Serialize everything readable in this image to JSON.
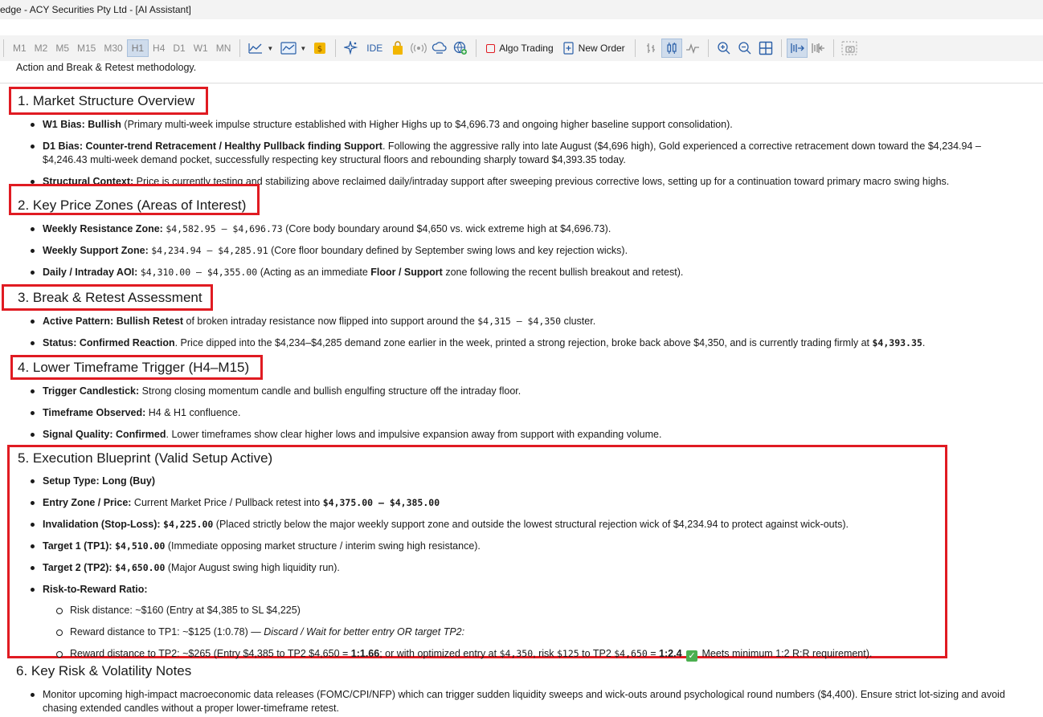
{
  "window": {
    "title": "edge - ACY Securities Pty Ltd - [AI Assistant]"
  },
  "toolbar": {
    "periods": [
      "M1",
      "M5",
      "M15",
      "M30",
      "H1",
      "H4",
      "D1",
      "W1",
      "MN"
    ],
    "periods_visible": [
      "M1",
      "M2",
      "M5",
      "M15",
      "M30",
      "H1",
      "H4",
      "D1",
      "W1",
      "MN"
    ],
    "active_period": "H1",
    "ide_label": "IDE",
    "algo_trading_label": "Algo Trading",
    "new_order_label": "New Order",
    "colors": {
      "algo_stop": "#e01b22",
      "active_bg": "#cfdcec"
    }
  },
  "intro_tail": "Action and Break & Retest methodology.",
  "sections": {
    "s1": {
      "title": "1. Market Structure Overview",
      "b1_label": "W1 Bias: Bullish",
      "b1_text": " (Primary multi-week impulse structure established with Higher Highs up to $4,696.73 and ongoing higher baseline support consolidation).",
      "b2_label": "D1 Bias: Counter-trend Retracement / Healthy Pullback finding Support",
      "b2_text": ". Following the aggressive rally into late August ($4,696 high), Gold experienced a corrective retracement down toward the $4,234.94 – $4,246.43 multi-week demand pocket, successfully respecting key structural floors and rebounding sharply toward $4,393.35 today.",
      "b3_label": "Structural Context:",
      "b3_text": " Price is currently testing and stabilizing above reclaimed daily/intraday support after sweeping previous corrective lows, setting up for a continuation toward primary macro swing highs."
    },
    "s2": {
      "title": "2. Key Price Zones (Areas of Interest)",
      "b1_label": "Weekly Resistance Zone:",
      "b1_code": "$4,582.95 – $4,696.73",
      "b1_text": " (Core body boundary around $4,650 vs. wick extreme high at $4,696.73).",
      "b2_label": "Weekly Support Zone:",
      "b2_code": "$4,234.94 – $4,285.91",
      "b2_text": " (Core floor boundary defined by September swing lows and key rejection wicks).",
      "b3_label": "Daily / Intraday AOI:",
      "b3_code": "$4,310.00 – $4,355.00",
      "b3_text_a": " (Acting as an immediate ",
      "b3_bold": "Floor / Support",
      "b3_text_b": " zone following the recent bullish breakout and retest)."
    },
    "s3": {
      "title": "3. Break & Retest Assessment",
      "b1_label": "Active Pattern: Bullish Retest",
      "b1_text_a": " of broken intraday resistance now flipped into support around the ",
      "b1_code": "$4,315 – $4,350",
      "b1_text_b": " cluster.",
      "b2_label": "Status: Confirmed Reaction",
      "b2_text": ". Price dipped into the $4,234–$4,285 demand zone earlier in the week, printed a strong rejection, broke back above $4,350, and is currently trading firmly at ",
      "b2_code": "$4,393.35",
      "b2_end": "."
    },
    "s4": {
      "title": "4. Lower Timeframe Trigger (H4–M15)",
      "b1_label": "Trigger Candlestick:",
      "b1_text": " Strong closing momentum candle and bullish engulfing structure off the intraday floor.",
      "b2_label": "Timeframe Observed:",
      "b2_text": " H4 & H1 confluence.",
      "b3_label": "Signal Quality: Confirmed",
      "b3_text": ". Lower timeframes show clear higher lows and impulsive expansion away from support with expanding volume."
    },
    "s5": {
      "title": "5. Execution Blueprint (Valid Setup Active)",
      "b1_label": "Setup Type: Long (Buy)",
      "b2_label": "Entry Zone / Price:",
      "b2_text": " Current Market Price / Pullback retest into ",
      "b2_code": "$4,375.00 – $4,385.00",
      "b3_label": "Invalidation (Stop-Loss):",
      "b3_code": "$4,225.00",
      "b3_text": " (Placed strictly below the major weekly support zone and outside the lowest structural rejection wick of $4,234.94 to protect against wick-outs).",
      "b4_label": "Target 1 (TP1):",
      "b4_code": "$4,510.00",
      "b4_text": " (Immediate opposing market structure / interim swing high resistance).",
      "b5_label": "Target 2 (TP2):",
      "b5_code": "$4,650.00",
      "b5_text": " (Major August swing high liquidity run).",
      "b6_label": "Risk-to-Reward Ratio:",
      "sub1": "Risk distance: ~$160 (Entry at $4,385 to SL $4,225)",
      "sub2_a": "Reward distance to TP1: ~$125 (1:0.78) — ",
      "sub2_i": "Discard / Wait for better entry OR target TP2:",
      "sub3_a": "Reward distance to TP2: ~$265 (Entry $4,385 to TP2 $4,650 = ",
      "sub3_b1": "1:1.66",
      "sub3_b": "; or with optimized entry at ",
      "sub3_code1": "$4,350",
      "sub3_c": ", risk ",
      "sub3_code2": "$125",
      "sub3_d": " to TP2 ",
      "sub3_code3": "$4,650",
      "sub3_e": " = ",
      "sub3_b2": "1:2.4",
      "sub3_f": " Meets minimum 1:2 R:R requirement)."
    },
    "s6": {
      "title": "6. Key Risk & Volatility Notes",
      "b1_text": "Monitor upcoming high-impact macroeconomic data releases (FOMC/CPI/NFP) which can trigger sudden liquidity sweeps and wick-outs around psychological round numbers ($4,400). Ensure strict lot-sizing and avoid chasing extended candles without a proper lower-timeframe retest."
    }
  },
  "colors": {
    "highlight_box": "#e01b22",
    "check": "#4caf50"
  }
}
